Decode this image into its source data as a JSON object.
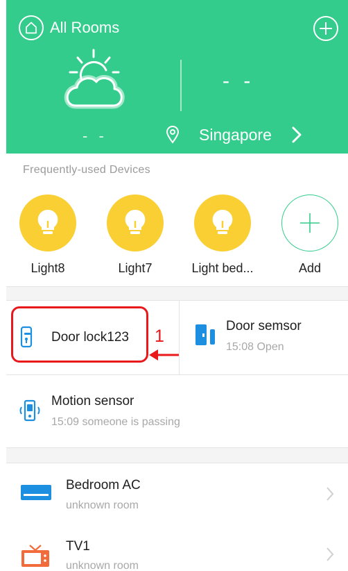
{
  "header": {
    "title": "All Rooms",
    "temperature": "- -",
    "humidity": "- -",
    "city": "Singapore"
  },
  "frequent": {
    "title": "Frequently-used Devices",
    "devices": [
      {
        "label": "Light8",
        "icon": "bulb-icon"
      },
      {
        "label": "Light7",
        "icon": "bulb-icon"
      },
      {
        "label": "Light bed...",
        "icon": "bulb-icon"
      },
      {
        "label": "Add",
        "icon": "plus-icon"
      }
    ]
  },
  "cards": {
    "door_lock": {
      "title": "Door lock123"
    },
    "door_sensor": {
      "title": "Door semsor",
      "status": "15:08 Open"
    },
    "motion_sensor": {
      "title": "Motion sensor",
      "status": "15:09 someone is passing"
    }
  },
  "annotation": {
    "number": "1",
    "color": "#e8181b"
  },
  "list": [
    {
      "title": "Bedroom AC",
      "room": "unknown room",
      "icon": "air-conditioner-icon"
    },
    {
      "title": "TV1",
      "room": "unknown room",
      "icon": "tv-icon"
    }
  ],
  "colors": {
    "header": "#33cc8c",
    "bulb": "#f9cf33",
    "device_blue": "#1d8fe1",
    "tv_orange": "#f26b3a"
  }
}
